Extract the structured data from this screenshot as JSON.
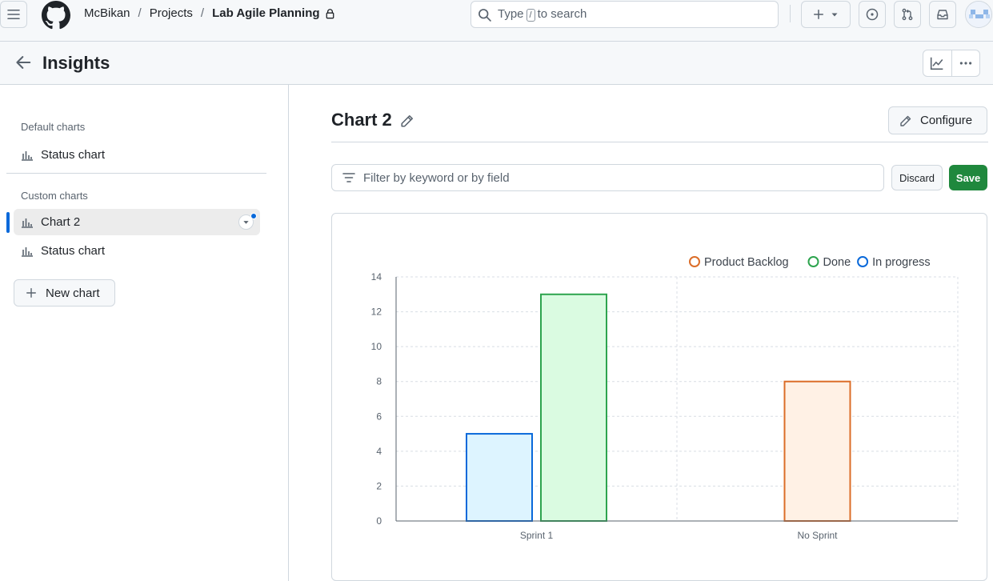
{
  "header": {
    "breadcrumbs": [
      {
        "label": "McBikan"
      },
      {
        "label": "Projects"
      },
      {
        "label": "Lab Agile Planning",
        "private": true
      }
    ],
    "separator": "/",
    "search": {
      "prefix": "Type",
      "key": "/",
      "suffix": "to search"
    }
  },
  "subheader": {
    "title": "Insights"
  },
  "sidebar": {
    "default_heading": "Default charts",
    "default_items": [
      {
        "label": "Status chart"
      }
    ],
    "custom_heading": "Custom charts",
    "custom_items": [
      {
        "label": "Chart 2",
        "active": true
      },
      {
        "label": "Status chart"
      }
    ],
    "new_chart_label": "New chart"
  },
  "main": {
    "chart_title": "Chart 2",
    "configure_label": "Configure",
    "filter_placeholder": "Filter by keyword or by field",
    "discard_label": "Discard",
    "save_label": "Save"
  },
  "colors": {
    "accent": "#0969da",
    "save_green": "#1f883d",
    "product_backlog": "#db6d28",
    "done": "#2da44e",
    "in_progress": "#0969da"
  },
  "chart_data": {
    "type": "bar",
    "categories": [
      "Sprint 1",
      "No Sprint"
    ],
    "series": [
      {
        "name": "In progress",
        "values": [
          5,
          0
        ],
        "color": "#0969da",
        "fill": "#ddf4ff"
      },
      {
        "name": "Done",
        "values": [
          13,
          0
        ],
        "color": "#2da44e",
        "fill": "#dafbe1"
      },
      {
        "name": "Product Backlog",
        "values": [
          0,
          8
        ],
        "color": "#db6d28",
        "fill": "#fff1e5"
      }
    ],
    "legend_order": [
      "Product Backlog",
      "Done",
      "In progress"
    ],
    "legend_position": "top-right",
    "yticks": [
      0,
      2,
      4,
      6,
      8,
      10,
      12,
      14
    ],
    "ylim": [
      0,
      14
    ],
    "grid": true
  }
}
